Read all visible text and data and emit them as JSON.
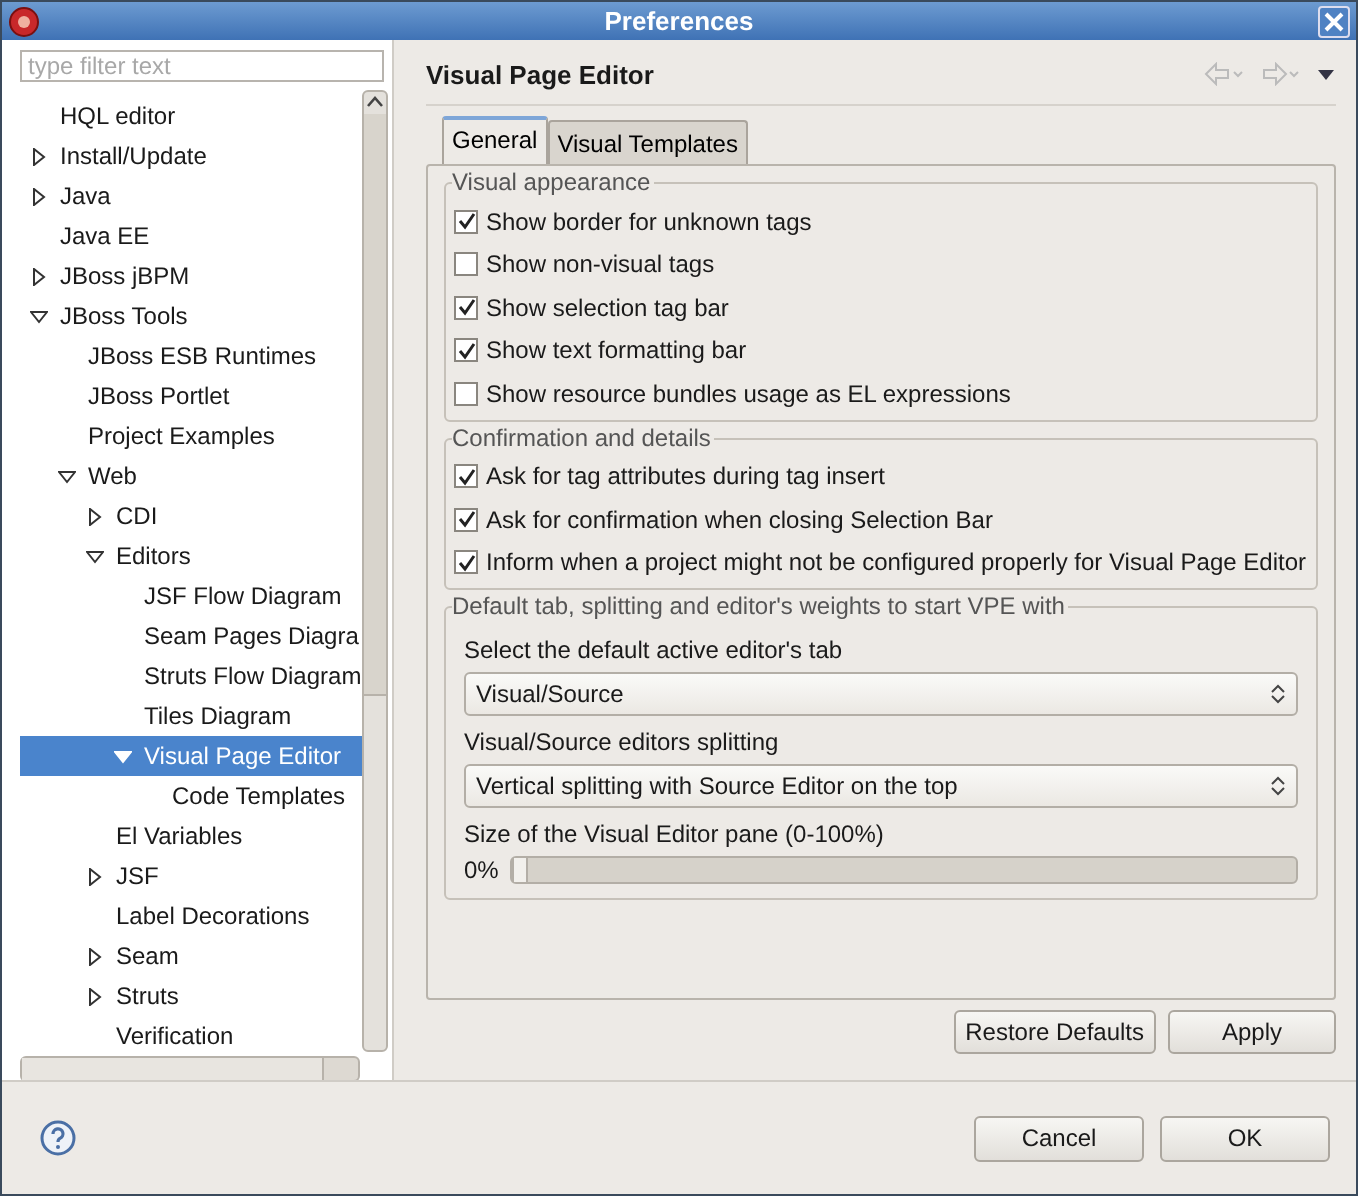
{
  "window": {
    "title": "Preferences"
  },
  "filter": {
    "placeholder": "type filter text"
  },
  "tree": [
    {
      "label": "HQL editor",
      "selected": false
    },
    {
      "label": "Install/Update",
      "selected": false,
      "expanded": false
    },
    {
      "label": "Java",
      "selected": false,
      "expanded": false
    },
    {
      "label": "Java EE",
      "selected": false
    },
    {
      "label": "JBoss jBPM",
      "selected": false,
      "expanded": false
    },
    {
      "label": "JBoss Tools",
      "selected": false,
      "expanded": true,
      "children": [
        {
          "label": "JBoss ESB Runtimes",
          "selected": false
        },
        {
          "label": "JBoss Portlet",
          "selected": false
        },
        {
          "label": "Project Examples",
          "selected": false
        },
        {
          "label": "Web",
          "selected": false,
          "expanded": true,
          "children": [
            {
              "label": "CDI",
              "selected": false,
              "expanded": false
            },
            {
              "label": "Editors",
              "selected": false,
              "expanded": true,
              "children": [
                {
                  "label": "JSF Flow Diagram",
                  "selected": false
                },
                {
                  "label": "Seam Pages Diagra",
                  "selected": false
                },
                {
                  "label": "Struts Flow Diagram",
                  "selected": false
                },
                {
                  "label": "Tiles Diagram",
                  "selected": false
                },
                {
                  "label": "Visual Page Editor",
                  "selected": true,
                  "expanded": true,
                  "children": [
                    {
                      "label": "Code Templates",
                      "selected": false
                    }
                  ]
                }
              ]
            },
            {
              "label": "El Variables",
              "selected": false
            },
            {
              "label": "JSF",
              "selected": false,
              "expanded": false
            },
            {
              "label": "Label Decorations",
              "selected": false
            },
            {
              "label": "Seam",
              "selected": false,
              "expanded": false
            },
            {
              "label": "Struts",
              "selected": false,
              "expanded": false
            },
            {
              "label": "Verification",
              "selected": false
            }
          ]
        }
      ]
    }
  ],
  "page": {
    "title": "Visual Page Editor"
  },
  "tabs": [
    {
      "label": "General",
      "selected": true
    },
    {
      "label": "Visual Templates",
      "selected": false
    }
  ],
  "groups": [
    {
      "title": "Visual appearance",
      "options": [
        {
          "label": "Show border for unknown tags",
          "checked": true
        },
        {
          "label": "Show non-visual tags",
          "checked": false
        },
        {
          "label": "Show selection tag bar",
          "checked": true
        },
        {
          "label": "Show text formatting bar",
          "checked": true
        },
        {
          "label": "Show resource bundles usage as EL expressions",
          "checked": false
        }
      ]
    },
    {
      "title": "Confirmation and details",
      "options": [
        {
          "label": "Ask for tag attributes during tag insert",
          "checked": true
        },
        {
          "label": "Ask for confirmation when closing Selection Bar",
          "checked": true
        },
        {
          "label": "Inform when a project might not be configured properly for Visual Page Editor",
          "checked": true
        }
      ]
    }
  ],
  "defaults_group": {
    "title": "Default tab, splitting and editor's weights to start VPE with",
    "tab_label": "Select the default active editor's tab",
    "tab_value": "Visual/Source",
    "split_label": "Visual/Source editors splitting",
    "split_value": "Vertical splitting with Source Editor on the top",
    "size_label": "Size of the Visual Editor pane (0-100%)",
    "weight_slider": {
      "reading": "0%",
      "level": 0
    }
  },
  "page_buttons": [
    "Restore Defaults",
    "Apply"
  ],
  "dialog_buttons": [
    "Cancel",
    "OK"
  ]
}
